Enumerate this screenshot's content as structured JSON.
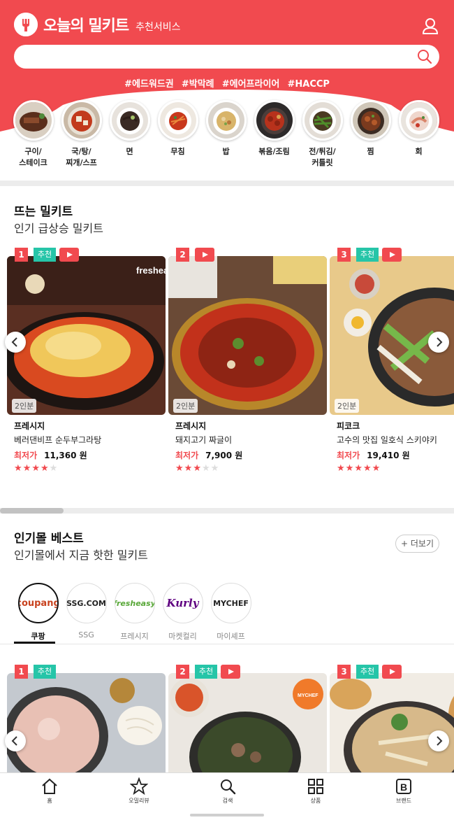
{
  "header": {
    "logo_text": "오늘의 밀키트",
    "logo_sub": "추천서비스",
    "search_placeholder": "",
    "hashtags": [
      "#에드워드권",
      "#박막례",
      "#에어프라이어",
      "#HACCP"
    ],
    "brand_color": "#f14a4f"
  },
  "categories": [
    {
      "label": "구이/\n스테이크"
    },
    {
      "label": "국/탕/\n찌개/스프"
    },
    {
      "label": "면"
    },
    {
      "label": "무침"
    },
    {
      "label": "밥"
    },
    {
      "label": "볶음/조림"
    },
    {
      "label": "전/튀김/\n커틀릿"
    },
    {
      "label": "찜"
    },
    {
      "label": "회"
    }
  ],
  "trending": {
    "title": "뜨는 밀키트",
    "subtitle": "인기 급상승 밀키트",
    "items": [
      {
        "rank": "1",
        "rec": "추천",
        "serving": "2인분",
        "brand": "프레시지",
        "name": "베러댄비프 순두부그라탕",
        "price_label": "최저가",
        "price": "11,360 원",
        "rating": 4
      },
      {
        "rank": "2",
        "rec": "",
        "serving": "2인분",
        "brand": "프레시지",
        "name": "돼지고기 짜글이",
        "price_label": "최저가",
        "price": "7,900 원",
        "rating": 3
      },
      {
        "rank": "3",
        "rec": "추천",
        "serving": "2인분",
        "brand": "피코크",
        "name": "고수의 맛집 일호식 스키야키",
        "price_label": "최저가",
        "price": "19,410 원",
        "rating": 5
      }
    ],
    "scroll_position": 0.14
  },
  "mall_best": {
    "title": "인기몰 베스트",
    "subtitle": "인기몰에서 지금 핫한 밀키트",
    "more_label": "+ 더보기",
    "malls": [
      {
        "logo": "coupang",
        "label": "쿠팡",
        "active": true
      },
      {
        "logo": "SSG.COM",
        "label": "SSG",
        "active": false
      },
      {
        "logo": "fresheasy",
        "label": "프레시지",
        "active": false
      },
      {
        "logo": "Kurly",
        "label": "마켓컬리",
        "active": false
      },
      {
        "logo": "MYCHEF",
        "label": "마이셰프",
        "active": false
      }
    ],
    "items": [
      {
        "rank": "1",
        "rec": "추천"
      },
      {
        "rank": "2",
        "rec": "추천"
      },
      {
        "rank": "3",
        "rec": "추천"
      }
    ]
  },
  "bottom_nav": [
    {
      "label": "홈",
      "icon": "home-icon"
    },
    {
      "label": "오밀리뷰",
      "icon": "star-icon"
    },
    {
      "label": "검색",
      "icon": "search-icon"
    },
    {
      "label": "상품",
      "icon": "grid-icon"
    },
    {
      "label": "브랜드",
      "icon": "brand-b-icon"
    }
  ]
}
